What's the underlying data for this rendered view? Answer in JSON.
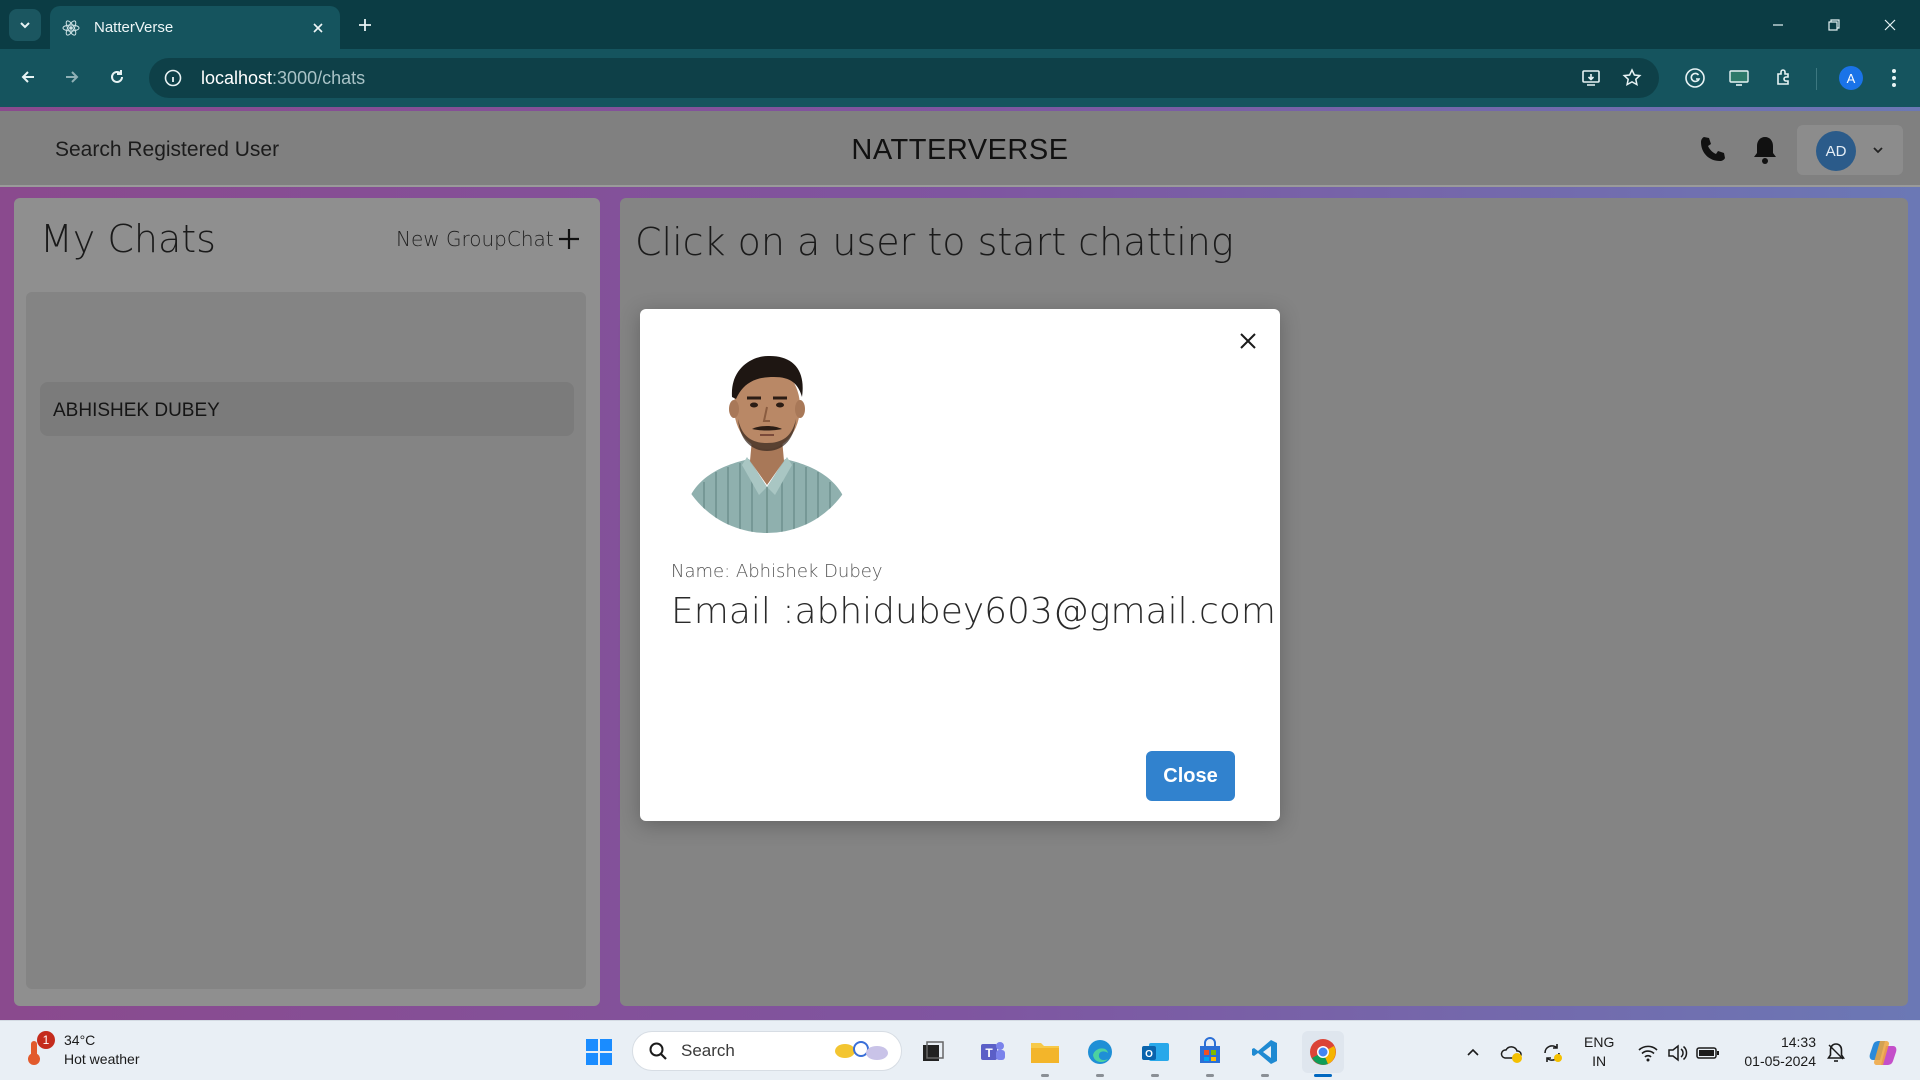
{
  "browser": {
    "tab_title": "NatterVerse",
    "url_host": "localhost",
    "url_path": ":3000/chats"
  },
  "header": {
    "search_label": "Search Registered User",
    "brand": "NATTERVERSE",
    "avatar_initials": "AD"
  },
  "chats": {
    "title": "My Chats",
    "new_group_label": "New GroupChat",
    "items": [
      "ABHISHEK DUBEY"
    ]
  },
  "main": {
    "placeholder": "Click on a user to start chatting"
  },
  "modal": {
    "name_line": "Name: Abhishek Dubey",
    "email_line": "Email :abhidubey603@gmail.com",
    "close_label": "Close"
  },
  "taskbar": {
    "weather_temp": "34°C",
    "weather_desc": "Hot weather",
    "weather_badge": "1",
    "search_placeholder": "Search",
    "lang_primary": "ENG",
    "lang_secondary": "IN",
    "time": "14:33",
    "date": "01-05-2024"
  },
  "profile_initial": "A",
  "colors": {
    "browser_frame": "#0b3c44",
    "browser_toolbar": "#15545e",
    "app_header": "#808080",
    "primary_button": "#3182ce",
    "avatar_bg": "#2b5b8a"
  }
}
